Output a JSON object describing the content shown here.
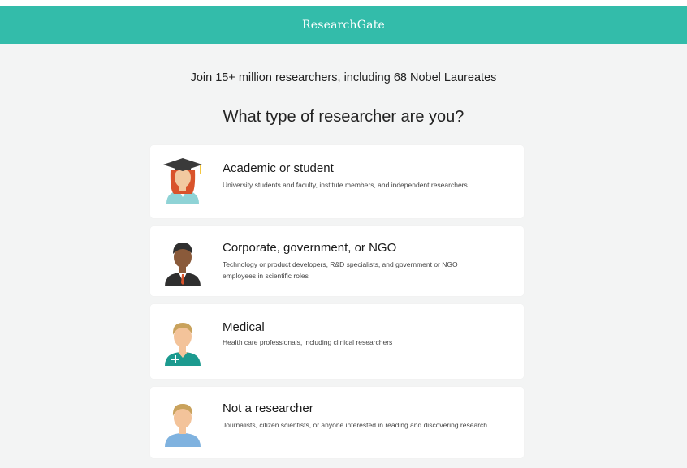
{
  "header": {
    "brand": "ResearchGate"
  },
  "intro": {
    "tagline": "Join 15+ million researchers, including 68 Nobel Laureates",
    "question": "What type of researcher are you?"
  },
  "options": [
    {
      "title": "Academic or student",
      "description": "University students and faculty, institute members, and independent researchers",
      "icon": "graduate-avatar-icon"
    },
    {
      "title": "Corporate, government, or NGO",
      "description": "Technology or product developers, R&D specialists, and government or NGO employees in scientific roles",
      "icon": "business-avatar-icon"
    },
    {
      "title": "Medical",
      "description": "Health care professionals, including clinical researchers",
      "icon": "medic-avatar-icon"
    },
    {
      "title": "Not a researcher",
      "description": "Journalists, citizen scientists, or anyone interested in reading and discovering research",
      "icon": "person-avatar-icon"
    }
  ],
  "colors": {
    "brand": "#33bcaa",
    "background": "#f3f4f4",
    "card": "#ffffff"
  }
}
